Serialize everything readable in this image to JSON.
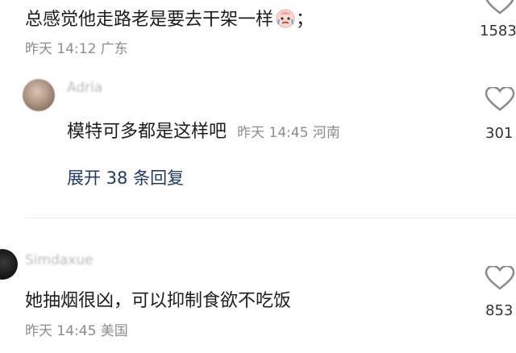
{
  "comments": [
    {
      "text": "总感觉他走路老是要去干架一样",
      "suffix": "；",
      "emoji": "crying-face-emoji",
      "meta": "昨天 14:12 广东",
      "likes": "1583"
    },
    {
      "username": "Adria",
      "text": "模特可多都是这样吧",
      "meta": "昨天 14:45 河南",
      "likes": "301",
      "expand_label": "展开 38 条回复"
    },
    {
      "username": "Simdaxue",
      "text": "她抽烟很凶，可以抑制食欲不吃饭",
      "meta": "昨天 14:45 美国",
      "likes": "853"
    }
  ],
  "colors": {
    "link": "#1f3a63",
    "meta": "#8c8c8c",
    "heart_stroke": "#8a8a8a"
  }
}
